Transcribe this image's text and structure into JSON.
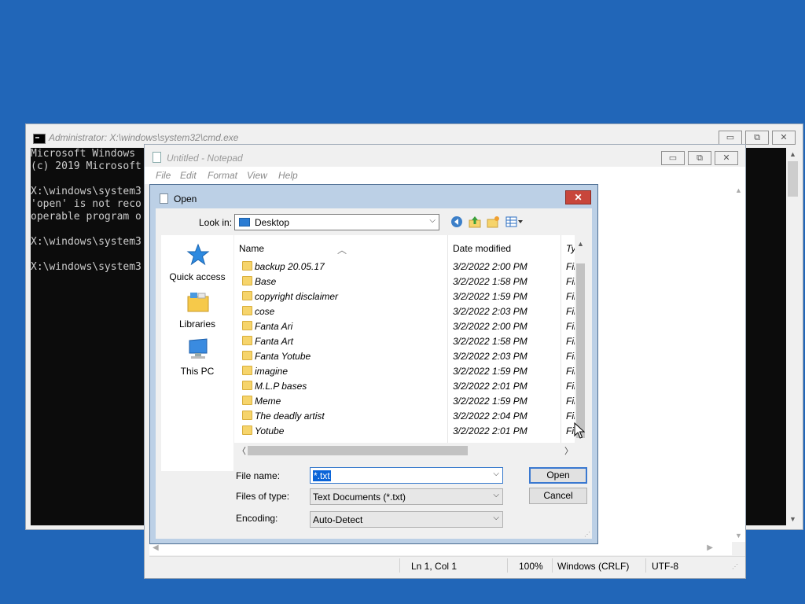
{
  "cmd": {
    "title": "Administrator: X:\\windows\\system32\\cmd.exe",
    "lines": [
      "Microsoft Windows ",
      "(c) 2019 Microsoft",
      "",
      "X:\\windows\\system3",
      "'open' is not reco",
      "operable program o",
      "",
      "X:\\windows\\system3",
      "",
      "X:\\windows\\system3"
    ]
  },
  "notepad": {
    "title": "Untitled - Notepad",
    "menu": [
      "File",
      "Edit",
      "Format",
      "View",
      "Help"
    ],
    "status": {
      "position": "Ln 1, Col 1",
      "zoom": "100%",
      "line_ending": "Windows (CRLF)",
      "encoding": "UTF-8"
    }
  },
  "dialog": {
    "title": "Open",
    "close_label": "✕",
    "look_in_label": "Look in:",
    "look_in_value": "Desktop",
    "places": [
      {
        "label": "Quick access",
        "icon": "quick-access-icon"
      },
      {
        "label": "Libraries",
        "icon": "libraries-icon"
      },
      {
        "label": "This PC",
        "icon": "this-pc-icon"
      }
    ],
    "columns": {
      "name": "Name",
      "date": "Date modified",
      "type": "Ty"
    },
    "files": [
      {
        "name": "backup 20.05.17",
        "date": "3/2/2022 2:00 PM",
        "type": "Fil"
      },
      {
        "name": "Base",
        "date": "3/2/2022 1:58 PM",
        "type": "Fil"
      },
      {
        "name": "copyright disclaimer",
        "date": "3/2/2022 1:59 PM",
        "type": "Fil"
      },
      {
        "name": "cose",
        "date": "3/2/2022 2:03 PM",
        "type": "Fil"
      },
      {
        "name": "Fanta Ari",
        "date": "3/2/2022 2:00 PM",
        "type": "Fil"
      },
      {
        "name": "Fanta Art",
        "date": "3/2/2022 1:58 PM",
        "type": "Fil"
      },
      {
        "name": "Fanta Yotube",
        "date": "3/2/2022 2:03 PM",
        "type": "Fil"
      },
      {
        "name": "imagine",
        "date": "3/2/2022 1:59 PM",
        "type": "Fil"
      },
      {
        "name": "M.L.P bases",
        "date": "3/2/2022 2:01 PM",
        "type": "Fil"
      },
      {
        "name": "Meme",
        "date": "3/2/2022 1:59 PM",
        "type": "Fil"
      },
      {
        "name": "The deadly artist",
        "date": "3/2/2022 2:04 PM",
        "type": "Fil"
      },
      {
        "name": "Yotube",
        "date": "3/2/2022 2:01 PM",
        "type": "Fil"
      }
    ],
    "file_name_label": "File name:",
    "file_name_value": "*.txt",
    "file_type_label": "Files of type:",
    "file_type_value": "Text Documents (*.txt)",
    "encoding_label": "Encoding:",
    "encoding_value": "Auto-Detect",
    "open_label": "Open",
    "cancel_label": "Cancel"
  },
  "colors": {
    "desktop": "#2166b8",
    "dialog_frame": "#bcd0e6",
    "close_red": "#c8463b",
    "folder": "#f6d46b",
    "selection": "#0a64d8"
  }
}
